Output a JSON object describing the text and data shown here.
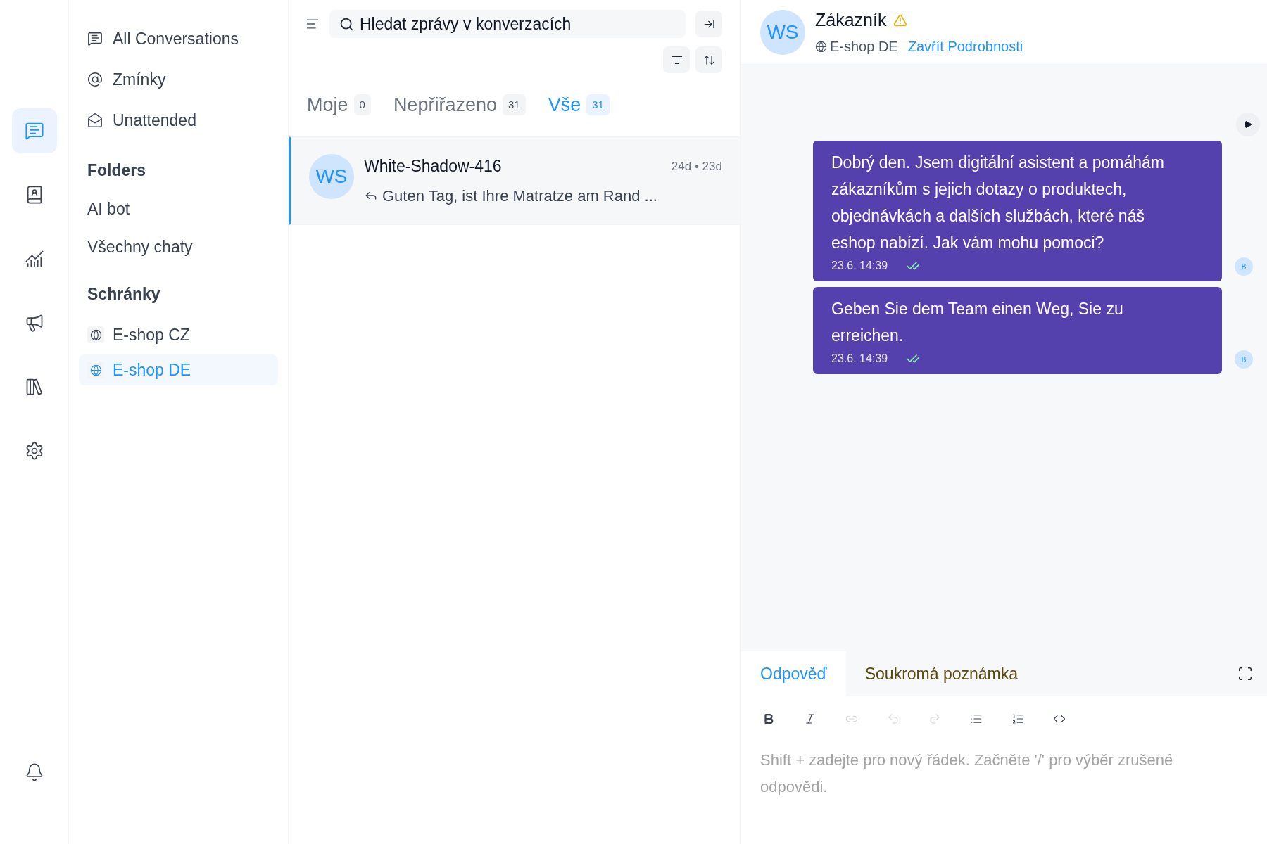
{
  "rail": [
    {
      "kind": "conversations",
      "selected": true
    },
    {
      "kind": "contacts",
      "selected": false
    },
    {
      "kind": "reports",
      "selected": false
    },
    {
      "kind": "campaigns",
      "selected": false
    },
    {
      "kind": "library",
      "selected": false
    },
    {
      "kind": "settings",
      "selected": false
    }
  ],
  "sidebar": {
    "views": [
      {
        "kind": "chat",
        "label": "All Conversations"
      },
      {
        "kind": "mention",
        "label": "Zmínky"
      },
      {
        "kind": "unattended",
        "label": "Unattended"
      }
    ],
    "folders_title": "Folders",
    "folders": [
      "AI bot",
      "Všechny chaty"
    ],
    "inboxes_title": "Schránky",
    "inboxes": [
      {
        "label": "E-shop CZ",
        "selected": false
      },
      {
        "label": "E-shop DE",
        "selected": true
      }
    ]
  },
  "list": {
    "search": {
      "placeholder": "Hledat zprávy v konverzacích"
    },
    "tabs": [
      {
        "label": "Moje",
        "count": "0",
        "selected": false
      },
      {
        "label": "Nepřiřazeno",
        "count": "31",
        "selected": false
      },
      {
        "label": "Vše",
        "count": "31",
        "selected": true
      }
    ],
    "conversations": [
      {
        "initials": "WS",
        "name": "White-Shadow-416",
        "time": "24d • 23d",
        "preview": "Guten Tag, ist Ihre Matratze am Rand ...",
        "selected": true
      }
    ]
  },
  "chat": {
    "initials": "WS",
    "title": "Zákazník",
    "inbox": "E-shop DE",
    "close_details": "Zavřít Podrobnosti",
    "messages": [
      {
        "text": "Dobrý den. Jsem digitální asistent a pomáhám zákazníkům s jejich dotazy o produktech, objednávkách a dalších službách, které náš eshop nabízí. Jak vám mohu pomoci?",
        "time": "23.6. 14:39",
        "read": true,
        "sender": "B"
      },
      {
        "text": "Geben Sie dem Team einen Weg, Sie zu erreichen.",
        "time": "23.6. 14:39",
        "read": true,
        "sender": "B"
      }
    ],
    "reply_tabs": [
      {
        "label": "Odpověď",
        "selected": true
      },
      {
        "label": "Soukromá poznámka",
        "selected": false
      }
    ],
    "toolbar": [
      {
        "kind": "bold",
        "disabled": false
      },
      {
        "kind": "italic",
        "disabled": false
      },
      {
        "kind": "link",
        "disabled": true
      },
      {
        "kind": "undo",
        "disabled": true
      },
      {
        "kind": "redo",
        "disabled": true
      },
      {
        "kind": "bullets",
        "disabled": false
      },
      {
        "kind": "numbers",
        "disabled": false
      },
      {
        "kind": "code",
        "disabled": false
      }
    ],
    "reply_placeholder": "Shift + zadejte pro nový řádek. Začněte '/' pro výběr zrušené odpovědi."
  }
}
